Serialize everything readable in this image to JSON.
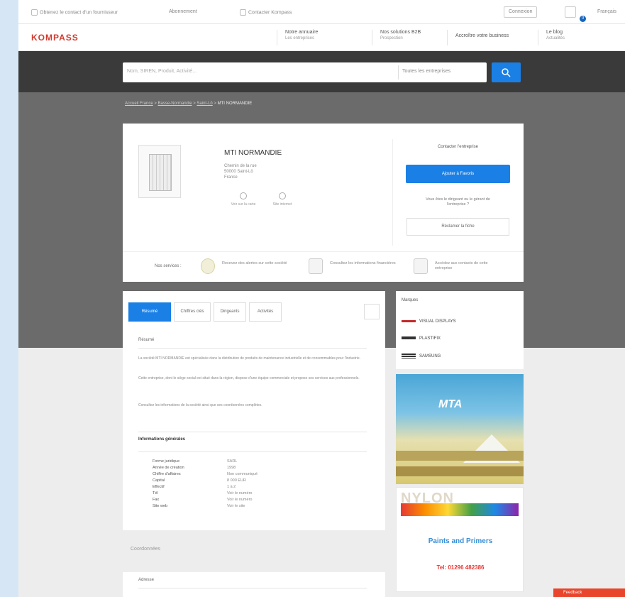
{
  "utility": {
    "phone": "Obtenez le contact d'un fournisseur",
    "link1": "Abonnement",
    "link2": "Contacter Kompass",
    "btn1": "Connexion",
    "lang": "Français",
    "badge": "0"
  },
  "header": {
    "logo": "KOMPASS",
    "nav": [
      {
        "label": "Notre annuaire",
        "sub": "Les entreprises"
      },
      {
        "label": "Nos solutions B2B",
        "sub": "Prospection"
      },
      {
        "label": "Accroître votre business",
        "sub": ""
      },
      {
        "label": "Le blog",
        "sub": "Actualités"
      }
    ]
  },
  "search": {
    "placeholder": "Nom, SIREN, Produit, Activité...",
    "select": "Toutes les entreprises"
  },
  "breadcrumb": [
    "Accueil France",
    "Basse-Normandie",
    "Saint-Lô",
    "MTI NORMANDIE"
  ],
  "company": {
    "name": "MTI NORMANDIE",
    "address": [
      "Chemin de la rue",
      "50000 Saint-Lô",
      "France"
    ],
    "actions": [
      "Voir sur la carte",
      "Site internet"
    ],
    "right_title": "Contacter l'entreprise",
    "contact_btn": "Ajouter à Favoris",
    "question": "Vous êtes le dirigeant ou le gérant de l'entreprise ?",
    "claim_btn": "Réclamer la fiche",
    "bottom_label": "Nos services :",
    "bottom_items": [
      "Recevez des alertes sur cette société",
      "Consultez les informations financières",
      "Accédez aux contacts de cette entreprise"
    ]
  },
  "tabs": [
    "Résumé",
    "Chiffres clés",
    "Dirigeants",
    "Activités"
  ],
  "summary": {
    "heading": "Résumé",
    "para1": "La société MTI NORMANDIE est spécialisée dans la distribution de produits de maintenance industrielle et de consommables pour l'industrie.",
    "para2": "Cette entreprise, dont le siège social est situé dans la région, dispose d'une équipe commerciale et propose ses services aux professionnels.",
    "para3": "Consultez les informations de la société ainsi que ses coordonnées complètes.",
    "info_heading": "Informations générales",
    "rows": [
      {
        "k": "Forme juridique",
        "v": "SARL"
      },
      {
        "k": "Année de création",
        "v": "1998"
      },
      {
        "k": "Chiffre d'affaires",
        "v": "Non communiqué"
      },
      {
        "k": "Capital",
        "v": "8 000 EUR"
      },
      {
        "k": "Effectif",
        "v": "1 à 2"
      },
      {
        "k": "Tél",
        "v": "Voir le numéro"
      },
      {
        "k": "Fax",
        "v": "Voir le numéro"
      },
      {
        "k": "Site web",
        "v": "Voir le site"
      }
    ]
  },
  "coordinates_heading": "Coordonnées",
  "address_card_heading": "Adresse",
  "right": {
    "title": "Marques",
    "brands": [
      "VISUAL DISPLAYS",
      "PLASTIFIX",
      "SAMSUNG"
    ]
  },
  "ads": {
    "mta": "MTA",
    "nylon": "NYLON",
    "paints": "Paints and Primers",
    "tel": "Tel: 01296 482386"
  },
  "feedback_label": "Feedback"
}
